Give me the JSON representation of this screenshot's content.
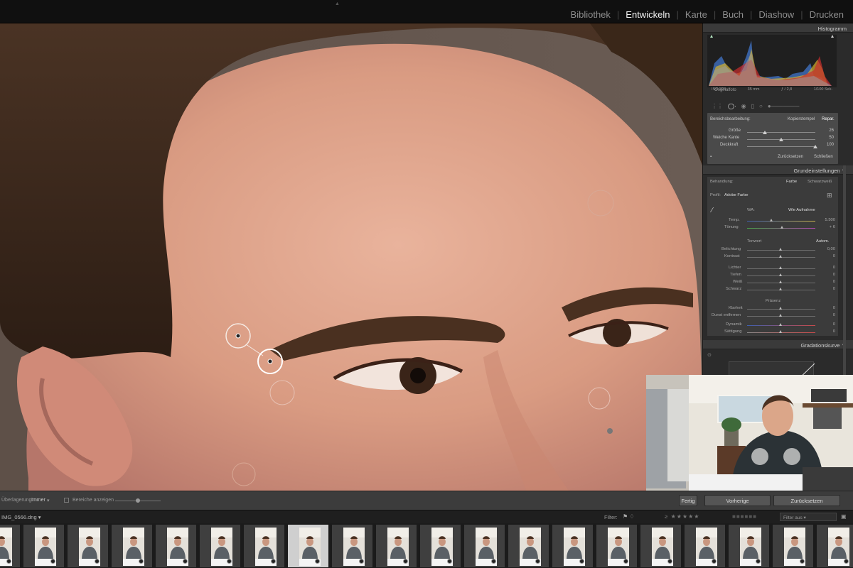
{
  "modules": {
    "items": [
      "Bibliothek",
      "Entwickeln",
      "Karte",
      "Buch",
      "Diashow",
      "Drucken"
    ],
    "active": "Entwickeln",
    "separator": "|"
  },
  "panel": {
    "histogram_title": "Histogramm",
    "histogram_info": [
      "ISO 320",
      "35 mm",
      "ƒ / 2,8",
      "1/100 Sek."
    ],
    "original_photo": "Originalfoto",
    "spot": {
      "label": "Bereichsbearbeitung:",
      "mode_clone": "Kopierstempel",
      "mode_heal": "Repar.",
      "size_label": "Größe",
      "size_value": "26",
      "feather_label": "Weiche Kante",
      "feather_value": "50",
      "opacity_label": "Deckkraft",
      "opacity_value": "100",
      "reset": "Zurücksetzen",
      "close": "Schließen"
    },
    "basic": {
      "title": "Grundeinstellungen",
      "treatment_label": "Behandlung:",
      "color": "Farbe",
      "bw": "Schwarzweiß",
      "profile_label": "Profil:",
      "profile_value": "Adobe Farbe",
      "wb_label": "WA:",
      "wb_value": "Wie Aufnahme",
      "temp_label": "Temp.",
      "temp_value": "5.500",
      "tint_label": "Tönung",
      "tint_value": "+ 6",
      "tone_label": "Tonwert",
      "auto": "Autom.",
      "exposure_label": "Belichtung",
      "exposure_value": "0,00",
      "contrast_label": "Kontrast",
      "contrast_value": "0",
      "highlights_label": "Lichter",
      "highlights_value": "0",
      "shadows_label": "Tiefen",
      "shadows_value": "0",
      "whites_label": "Weiß",
      "whites_value": "0",
      "blacks_label": "Schwarz",
      "blacks_value": "0",
      "presence_label": "Präsenz",
      "clarity_label": "Klarheit",
      "clarity_value": "0",
      "dehaze_label": "Dunst entfernen",
      "dehaze_value": "0",
      "vibrance_label": "Dynamik",
      "vibrance_value": "0",
      "saturation_label": "Sättigung",
      "saturation_value": "0"
    },
    "curve_title": "Gradationskurve"
  },
  "toolbar": {
    "overlay_label": "Überlagerung:",
    "overlay_value": "Immer",
    "show_spots": "Bereiche anzeigen",
    "done": "Fertig",
    "previous": "Vorherige",
    "reset": "Zurücksetzen"
  },
  "filmstrip": {
    "filename": "IMG_0566.dng",
    "filter_label": "Filter:",
    "filter_value": "Filter aus",
    "thumb_count": 20,
    "selected_index": 7
  }
}
